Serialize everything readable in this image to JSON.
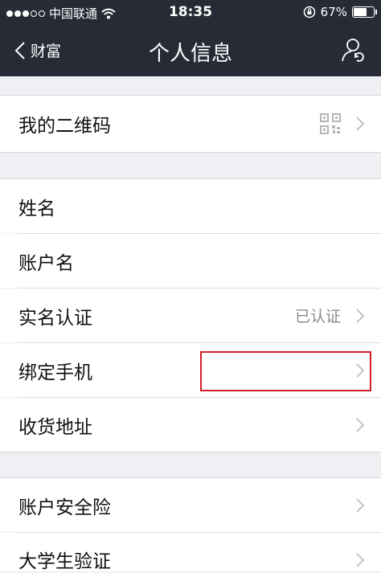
{
  "status_bar": {
    "carrier": "中国联通",
    "time": "18:35",
    "battery": "67%",
    "battery_level": 0.67,
    "icons": [
      "signal-dots-icon",
      "wifi-icon",
      "orientation-lock-icon",
      "battery-icon"
    ]
  },
  "nav": {
    "back_label": "财富",
    "title": "个人信息",
    "icons": [
      "back-chevron-icon",
      "profile-switch-icon"
    ]
  },
  "sections": [
    {
      "items": [
        {
          "label": "我的二维码",
          "icon": "qr-code-icon"
        }
      ]
    },
    {
      "items": [
        {
          "label": "姓名"
        },
        {
          "label": "账户名"
        },
        {
          "label": "实名认证",
          "value": "已认证"
        },
        {
          "label": "绑定手机",
          "value": ""
        },
        {
          "label": "收货地址"
        }
      ]
    },
    {
      "items": [
        {
          "label": "账户安全险"
        },
        {
          "label": "大学生验证"
        }
      ]
    }
  ],
  "colors": {
    "nav_background": "#262b36",
    "page_background": "#efeff4",
    "highlight_box": "#d21f26"
  }
}
